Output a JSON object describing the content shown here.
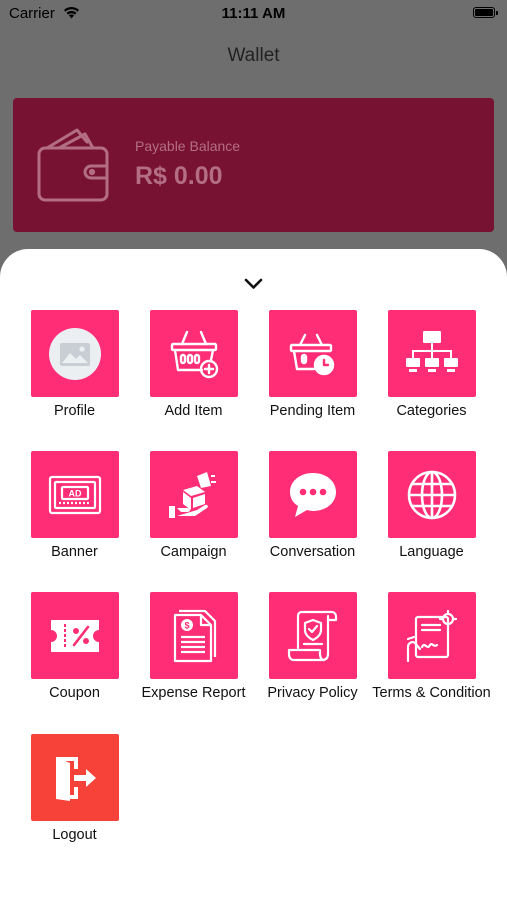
{
  "status_bar": {
    "carrier": "Carrier",
    "time": "11:11 AM"
  },
  "header": {
    "title": "Wallet"
  },
  "balance": {
    "label": "Payable Balance",
    "value": "R$ 0.00"
  },
  "menu": {
    "items": [
      {
        "label": "Profile",
        "icon": "profile-image-icon"
      },
      {
        "label": "Add Item",
        "icon": "basket-add-icon"
      },
      {
        "label": "Pending Item",
        "icon": "basket-clock-icon"
      },
      {
        "label": "Categories",
        "icon": "hierarchy-icon"
      },
      {
        "label": "Banner",
        "icon": "ad-banner-icon"
      },
      {
        "label": "Campaign",
        "icon": "megaphone-gift-icon"
      },
      {
        "label": "Conversation",
        "icon": "chat-bubble-icon"
      },
      {
        "label": "Language",
        "icon": "globe-icon"
      },
      {
        "label": "Coupon",
        "icon": "coupon-icon"
      },
      {
        "label": "Expense Report",
        "icon": "expense-report-icon"
      },
      {
        "label": "Privacy Policy",
        "icon": "privacy-scroll-icon"
      },
      {
        "label": "Terms & Condition",
        "icon": "contract-sign-icon"
      },
      {
        "label": "Logout",
        "icon": "logout-door-icon"
      }
    ]
  },
  "colors": {
    "tile": "#ff2d75",
    "logout_tile": "#f64238",
    "card": "#781232"
  }
}
